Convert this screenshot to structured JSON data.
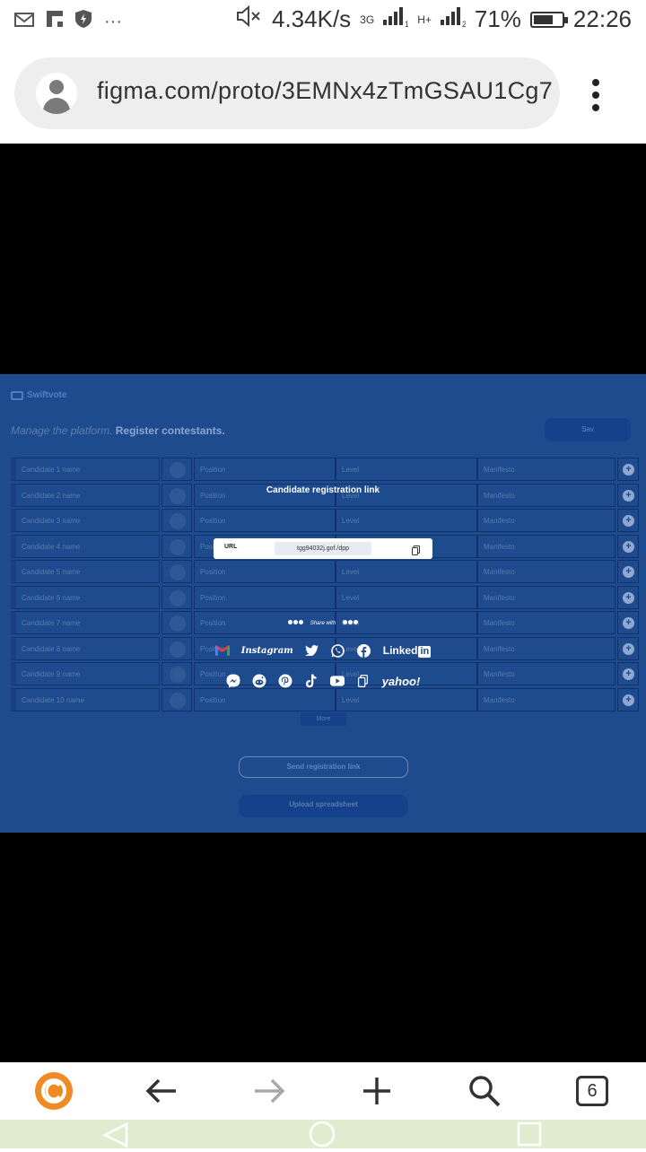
{
  "status_bar": {
    "speed": "4.34K/s",
    "network_1": "3G",
    "network_2": "H+",
    "battery_percent": "71%",
    "battery_level": 0.71,
    "time": "22:26",
    "icons": [
      "gmail-icon",
      "flipboard-icon",
      "shield-bolt-icon",
      "more-icon",
      "mute-icon",
      "signal-icon",
      "signal-icon",
      "battery-icon"
    ]
  },
  "browser": {
    "url": "figma.com/proto/3EMNx4zTmGSAU1Cg7",
    "tab_count": "6"
  },
  "app": {
    "logo_text": "Swiftvote",
    "subtitle_prefix": "Manage the platform.",
    "subtitle_main": "Register contestants.",
    "save_label": "Sav",
    "candidates": [
      {
        "name": "Candidate 1 name",
        "position": "Position",
        "level": "Level",
        "manifesto": "Manifesto"
      },
      {
        "name": "Candidate 2 name",
        "position": "Position",
        "level": "Level",
        "manifesto": "Manifesto"
      },
      {
        "name": "Candidate 3 name",
        "position": "Position",
        "level": "Level",
        "manifesto": "Manifesto"
      },
      {
        "name": "Candidate 4 name",
        "position": "Position",
        "level": "Level",
        "manifesto": "Manifesto"
      },
      {
        "name": "Candidate 5 name",
        "position": "Position",
        "level": "Level",
        "manifesto": "Manifesto"
      },
      {
        "name": "Candidate 6 name",
        "position": "Position",
        "level": "Level",
        "manifesto": "Manifesto"
      },
      {
        "name": "Candidate 7 name",
        "position": "Position",
        "level": "Level",
        "manifesto": "Manifesto"
      },
      {
        "name": "Candidate 8 name",
        "position": "Position",
        "level": "Level",
        "manifesto": "Manifesto"
      },
      {
        "name": "Candidate 9 name",
        "position": "Position",
        "level": "Level",
        "manifesto": "Manifesto"
      },
      {
        "name": "Candidate 10 name",
        "position": "Position",
        "level": "Level",
        "manifesto": "Manifesto"
      }
    ],
    "more_label": "More",
    "send_link_label": "Send registration link",
    "upload_label": "Upload spreadsheet"
  },
  "modal": {
    "title": "Candidate registration link",
    "url_label": "URL",
    "url_value": "tgg94032j.gof./dpp",
    "share_label": "Share with",
    "social_row_1": [
      "gmail-icon",
      "instagram-icon",
      "twitter-icon",
      "whatsapp-icon",
      "facebook-icon",
      "linkedin-icon"
    ],
    "social_row_2": [
      "messenger-icon",
      "reddit-icon",
      "pinterest-icon",
      "tiktok-icon",
      "youtube-icon",
      "copy-icon",
      "yahoo-icon"
    ],
    "instagram_text": "Instagram",
    "linkedin_text": "Linked",
    "linkedin_in": "in",
    "yahoo_text": "yahoo!"
  }
}
